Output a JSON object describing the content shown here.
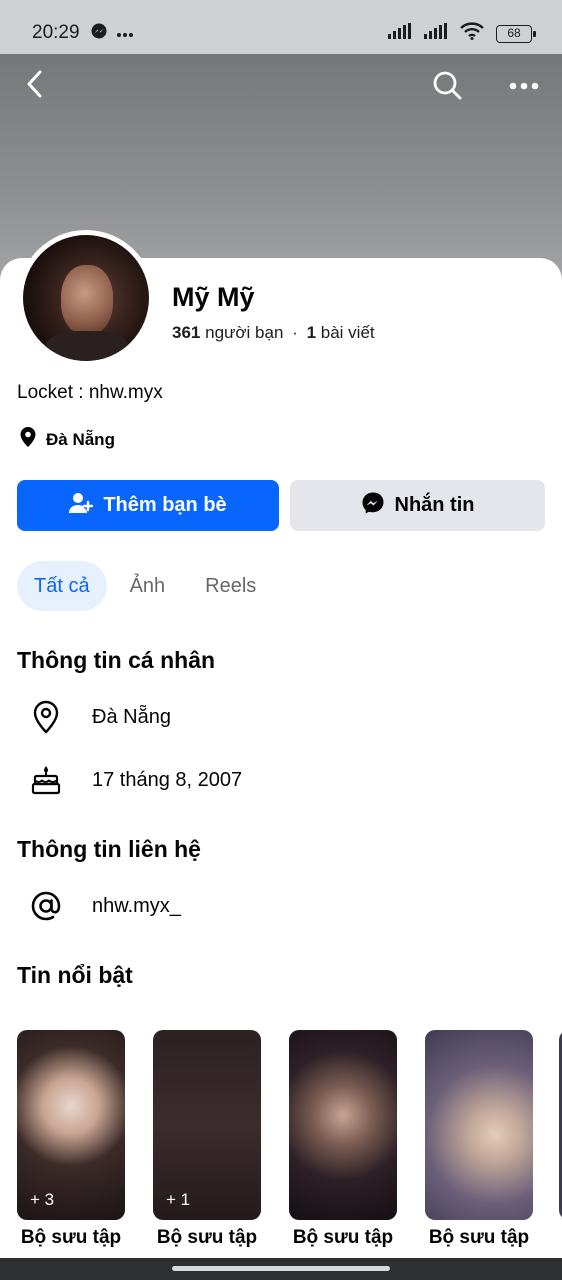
{
  "status_bar": {
    "time": "20:29",
    "battery": "68",
    "icons": [
      "messenger-notification-icon",
      "more-dots-icon",
      "signal-icon",
      "signal-icon",
      "wifi-icon",
      "battery-icon"
    ]
  },
  "header": {
    "icons": [
      "back-icon",
      "search-icon",
      "more-icon"
    ]
  },
  "profile": {
    "name": "Mỹ Mỹ",
    "friends_count": "361",
    "friends_label": "người bạn",
    "separator": "·",
    "posts_count": "1",
    "posts_label": "bài viết",
    "bio": "Locket : nhw.myx",
    "location": "Đà Nẵng"
  },
  "actions": {
    "add_friend": "Thêm bạn bè",
    "message": "Nhắn tin"
  },
  "tabs": [
    {
      "label": "Tất cả",
      "active": true
    },
    {
      "label": "Ảnh",
      "active": false
    },
    {
      "label": "Reels",
      "active": false
    }
  ],
  "personal_info": {
    "title": "Thông tin cá nhân",
    "location": "Đà Nẵng",
    "birthday": "17 tháng 8, 2007"
  },
  "contact_info": {
    "title": "Thông tin liên hệ",
    "handle": "nhw.myx_"
  },
  "highlights": {
    "title": "Tin nổi bật",
    "items": [
      {
        "label": "Bộ sưu tập",
        "count": "+ 3"
      },
      {
        "label": "Bộ sưu tập",
        "count": "+ 1"
      },
      {
        "label": "Bộ sưu tập",
        "count": ""
      },
      {
        "label": "Bộ sưu tập",
        "count": ""
      }
    ]
  },
  "colors": {
    "accent": "#0866ff",
    "secondary_button": "#e4e6eb",
    "active_tab_bg": "#e7f0fd",
    "muted_text": "#65676b"
  }
}
